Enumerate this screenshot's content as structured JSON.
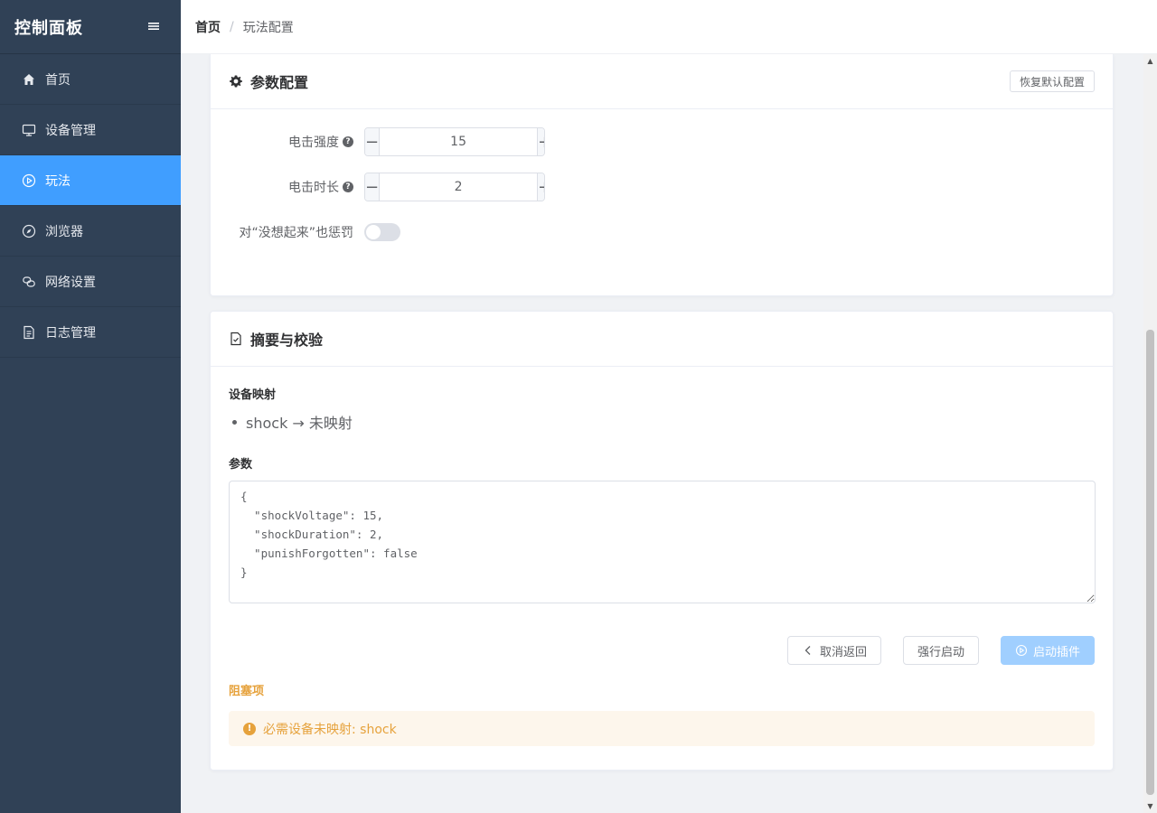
{
  "sidebar": {
    "title": "控制面板",
    "toggle_icon": "menu-icon",
    "items": [
      {
        "label": "首页",
        "icon": "home-icon",
        "active": false
      },
      {
        "label": "设备管理",
        "icon": "monitor-icon",
        "active": false
      },
      {
        "label": "玩法",
        "icon": "play-circle-icon",
        "active": true
      },
      {
        "label": "浏览器",
        "icon": "compass-icon",
        "active": false
      },
      {
        "label": "网络设置",
        "icon": "link-icon",
        "active": false
      },
      {
        "label": "日志管理",
        "icon": "document-icon",
        "active": false
      }
    ]
  },
  "breadcrumb": {
    "home": "首页",
    "separator": "/",
    "current": "玩法配置"
  },
  "params_card": {
    "title": "参数配置",
    "reset_label": "恢复默认配置",
    "fields": {
      "voltage": {
        "label": "电击强度",
        "value": "15"
      },
      "duration": {
        "label": "电击时长",
        "value": "2"
      },
      "punish": {
        "label": "对“没想起来”也惩罚",
        "enabled": false
      }
    }
  },
  "summary_card": {
    "title": "摘要与校验",
    "mapping_label": "设备映射",
    "mappings": [
      "shock → 未映射"
    ],
    "params_label": "参数",
    "params_json": "{\n  \"shockVoltage\": 15,\n  \"shockDuration\": 2,\n  \"punishForgotten\": false\n}",
    "cancel_label": "取消返回",
    "force_label": "强行启动",
    "start_label": "启动插件",
    "blockers_label": "阻塞项",
    "blocker_message": "必需设备未映射: shock"
  },
  "colors": {
    "sidebar_bg": "#304156",
    "accent": "#409eff",
    "warning": "#e6a23c"
  }
}
